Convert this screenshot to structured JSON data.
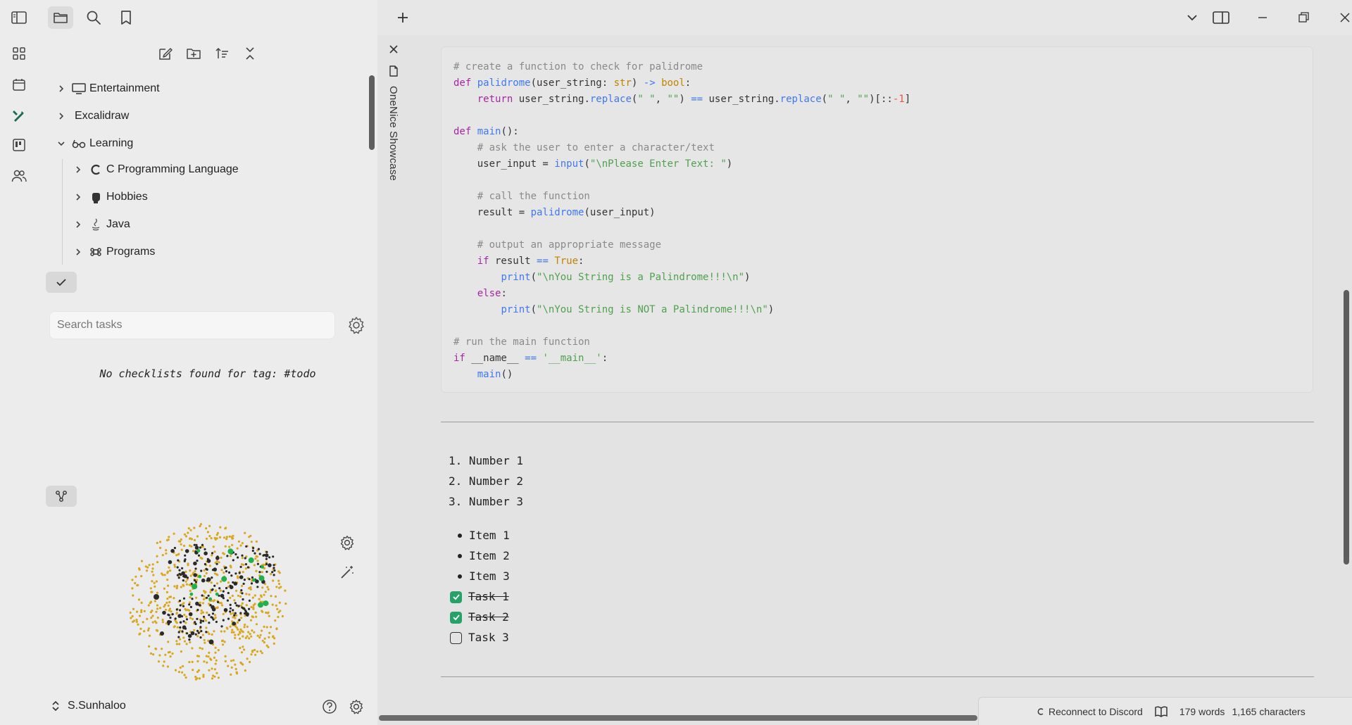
{
  "tabs": {
    "vertical_tab_title": "OneNice Showcase",
    "new_tab": "+"
  },
  "file_tree": {
    "items": [
      {
        "label": "Entertainment",
        "icon": "monitor-icon",
        "expanded": false
      },
      {
        "label": "Excalidraw",
        "icon": "",
        "expanded": false
      },
      {
        "label": "Learning",
        "icon": "glasses-icon",
        "expanded": true
      },
      {
        "label": "C Programming Language",
        "icon": "c-icon",
        "expanded": false
      },
      {
        "label": "Hobbies",
        "icon": "fist-icon",
        "expanded": false
      },
      {
        "label": "Java",
        "icon": "java-icon",
        "expanded": false
      },
      {
        "label": "Programs",
        "icon": "command-icon",
        "expanded": false
      }
    ]
  },
  "tasks": {
    "search_placeholder": "Search tasks",
    "empty_message": "No checklists found for tag: #todo"
  },
  "vault": {
    "name": "S.Sunhaloo"
  },
  "code": {
    "lines": [
      "# create a function to check for palidrome",
      "def palidrome(user_string: str) -> bool:",
      "    return user_string.replace(\" \", \"\") == user_string.replace(\" \", \"\")[::-1]",
      "",
      "def main():",
      "    # ask the user to enter a character/text",
      "    user_input = input(\"\\nPlease Enter Text: \")",
      "",
      "    # call the function",
      "    result = palidrome(user_input)",
      "",
      "    # output an appropriate message",
      "    if result == True:",
      "        print(\"\\nYou String is a Palindrome!!!\\n\")",
      "    else:",
      "        print(\"\\nYou String is NOT a Palindrome!!!\\n\")",
      "",
      "# run the main function",
      "if __name__ == '__main__':",
      "    main()"
    ]
  },
  "ordered_list": [
    "1. Number 1",
    "2. Number 2",
    "3. Number 3"
  ],
  "bullet_list": [
    "Item 1",
    "Item 2",
    "Item 3"
  ],
  "task_list": [
    {
      "label": "Task 1",
      "done": true
    },
    {
      "label": "Task 2",
      "done": true
    },
    {
      "label": "Task 3",
      "done": false
    }
  ],
  "status_bar": {
    "discord": "Reconnect to Discord",
    "words": "179 words",
    "characters": "1,165 characters"
  },
  "colors": {
    "accent_green": "#26a269",
    "graph_yellow": "#d9a820",
    "graph_dark": "#2a2a2a",
    "graph_green": "#1fb14a"
  }
}
